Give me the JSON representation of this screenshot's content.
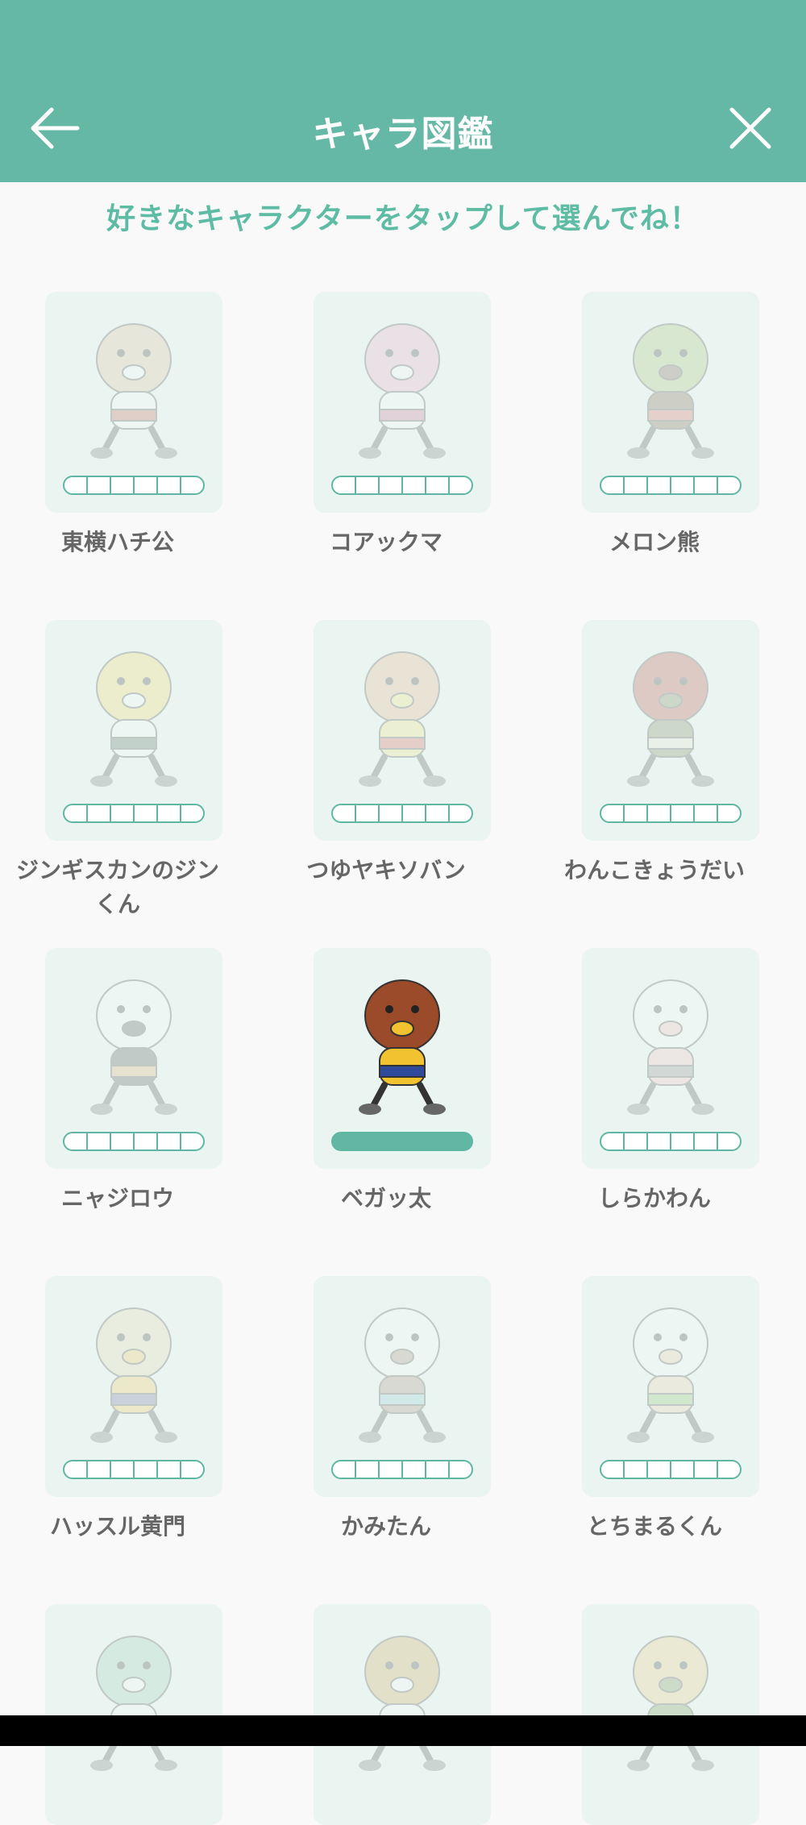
{
  "header": {
    "title": "キャラ図鑑",
    "back_icon": "arrow-left-icon",
    "close_icon": "close-icon",
    "color": "#65b8a5"
  },
  "instruction": "好きなキャラクターをタップして選んでね！",
  "characters": [
    {
      "name": "東横ハチ公",
      "unlocked": false
    },
    {
      "name": "コアックマ",
      "unlocked": false
    },
    {
      "name": "メロン熊",
      "unlocked": false
    },
    {
      "name": "ジンギスカンのジンくん",
      "unlocked": false
    },
    {
      "name": "つゆヤキソバン",
      "unlocked": false
    },
    {
      "name": "わんこきょうだい",
      "unlocked": false
    },
    {
      "name": "ニャジロウ",
      "unlocked": false
    },
    {
      "name": "ベガッ太",
      "unlocked": true
    },
    {
      "name": "しらかわん",
      "unlocked": false
    },
    {
      "name": "ハッスル黄門",
      "unlocked": false
    },
    {
      "name": "かみたん",
      "unlocked": false
    },
    {
      "name": "とちまるくん",
      "unlocked": false
    },
    {
      "name": "",
      "unlocked": false
    },
    {
      "name": "",
      "unlocked": false
    },
    {
      "name": "",
      "unlocked": false
    }
  ],
  "colors": {
    "accent": "#5fbca4",
    "card_bg": "#eaf4f1",
    "text": "#666666"
  }
}
